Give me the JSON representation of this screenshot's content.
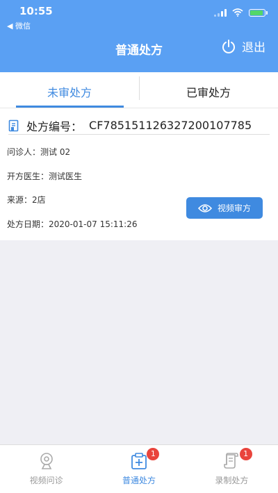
{
  "status_bar": {
    "time": "10:55",
    "back_app": "◀ 微信"
  },
  "header": {
    "title": "普通处方",
    "logout_label": "退出"
  },
  "tabs": [
    {
      "label": "未审处方",
      "active": true
    },
    {
      "label": "已审处方",
      "active": false
    }
  ],
  "prescription": {
    "number_label": "处方编号：",
    "number": "CF785151126327200107785",
    "patient_label": "问诊人：",
    "patient": "测试 02",
    "doctor_label": "开方医生：",
    "doctor": "测试医生",
    "source_label": "来源：",
    "source": "2店",
    "date_label": "处方日期：",
    "date": "2020-01-07 15:11:26",
    "video_button_label": "视频审方"
  },
  "bottom_nav": [
    {
      "label": "视频问诊",
      "icon": "webcam-icon",
      "badge": ""
    },
    {
      "label": "普通处方",
      "icon": "prescription-add-icon",
      "badge": "1"
    },
    {
      "label": "录制处方",
      "icon": "scroll-icon",
      "badge": "1"
    }
  ],
  "colors": {
    "primary": "#3f8ae0",
    "header": "#5aa0f3",
    "badge": "#e9443c"
  }
}
